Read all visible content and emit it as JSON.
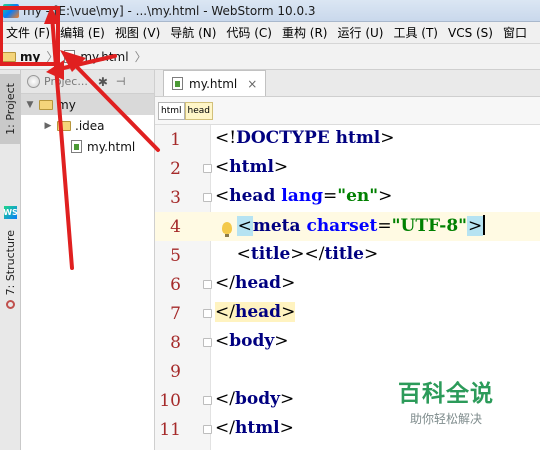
{
  "titlebar": {
    "text": "my - [E:\\vue\\my] - ...\\my.html - WebStorm 10.0.3"
  },
  "menu": [
    "文件 (F)",
    "编辑 (E)",
    "视图 (V)",
    "导航 (N)",
    "代码 (C)",
    "重构 (R)",
    "运行 (U)",
    "工具 (T)",
    "VCS (S)",
    "窗口"
  ],
  "breadcrumb": {
    "project": "my",
    "file": "my.html"
  },
  "tool_strip": {
    "project_tab": "1: Project",
    "structure_tab": "7: Structure",
    "ws_badge": "WS"
  },
  "project_panel": {
    "header": "Projec...",
    "tree": [
      {
        "label": "my",
        "arrow": "▼",
        "type": "folder"
      },
      {
        "label": ".idea",
        "arrow": "▶",
        "type": "folder"
      },
      {
        "label": "my.html",
        "arrow": "",
        "type": "file"
      }
    ]
  },
  "editor": {
    "tab_label": "my.html",
    "tab_close": "×",
    "tags": [
      "html",
      "head"
    ],
    "lines": [
      {
        "no": "1",
        "parts": [
          [
            "br",
            "<!"
          ],
          [
            "tg",
            "DOCTYPE "
          ],
          [
            "tg",
            "html"
          ],
          [
            "br",
            ">"
          ]
        ]
      },
      {
        "no": "2",
        "parts": [
          [
            "br",
            "<"
          ],
          [
            "tg",
            "html"
          ],
          [
            "br",
            ">"
          ]
        ]
      },
      {
        "no": "3",
        "parts": [
          [
            "br",
            "<"
          ],
          [
            "tg",
            "head "
          ],
          [
            "at",
            "lang"
          ],
          [
            "br",
            "="
          ],
          [
            "st",
            "\"en\""
          ],
          [
            "br",
            ">"
          ]
        ]
      },
      {
        "no": "4",
        "parts": [
          [
            "br",
            "    "
          ],
          [
            "hl",
            "<"
          ],
          [
            "tg",
            "meta "
          ],
          [
            "at",
            "charset"
          ],
          [
            "br",
            "="
          ],
          [
            "st",
            "\"UTF-8\""
          ],
          [
            "hl",
            ">"
          ]
        ]
      },
      {
        "no": "5",
        "parts": [
          [
            "br",
            "    <"
          ],
          [
            "tg",
            "title"
          ],
          [
            "br",
            "></"
          ],
          [
            "tg",
            "title"
          ],
          [
            "br",
            ">"
          ]
        ]
      },
      {
        "no": "6",
        "parts": [
          [
            "br",
            "</"
          ],
          [
            "tg",
            "head"
          ],
          [
            "br",
            ">"
          ]
        ]
      },
      {
        "no": "7",
        "parts": [
          [
            "hly",
            "</"
          ],
          [
            "tgy",
            "head"
          ],
          [
            "hly",
            ">"
          ]
        ]
      },
      {
        "no": "8",
        "parts": [
          [
            "br",
            "<"
          ],
          [
            "tg",
            "body"
          ],
          [
            "br",
            ">"
          ]
        ]
      },
      {
        "no": "9",
        "parts": []
      },
      {
        "no": "10",
        "parts": [
          [
            "br",
            "</"
          ],
          [
            "tg",
            "body"
          ],
          [
            "br",
            ">"
          ]
        ]
      },
      {
        "no": "11",
        "parts": [
          [
            "br",
            "</"
          ],
          [
            "tg",
            "html"
          ],
          [
            "br",
            ">"
          ]
        ]
      }
    ]
  },
  "watermark": {
    "title": "百科全说",
    "subtitle": "助你轻松解决"
  },
  "colors": {
    "annotation": "#e02020",
    "tag": "#000080",
    "attribute": "#0000ff",
    "string": "#008000",
    "line_number": "#a52a2a"
  }
}
